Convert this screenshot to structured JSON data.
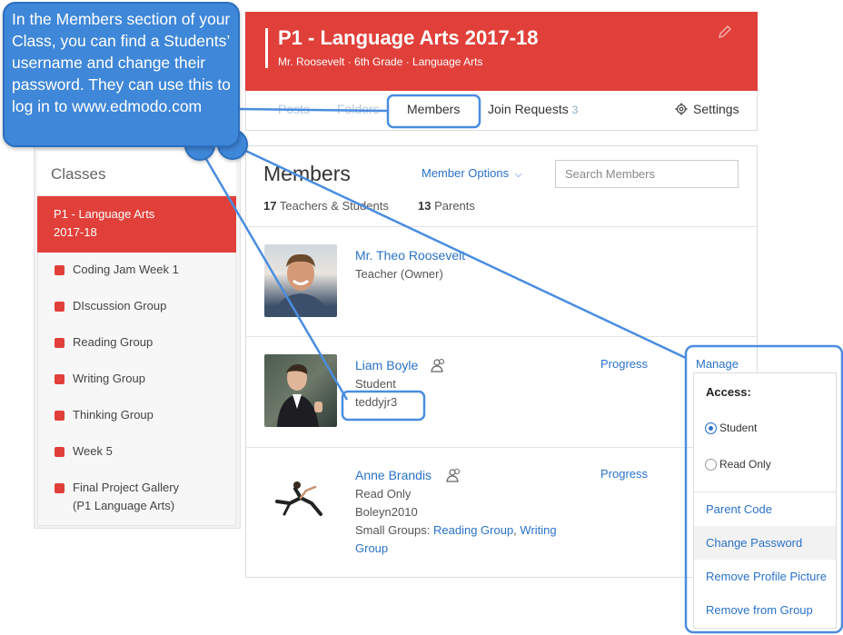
{
  "callout": {
    "text": "In the Members section of your Class, you can find a Students’ username and change their password. They can use this to log in to www.edmodo.com"
  },
  "sidebar": {
    "title": "Classes",
    "active_line1": "P1 - Language Arts",
    "active_line2": "2017-18",
    "items": [
      {
        "label": "Coding Jam Week 1"
      },
      {
        "label": "DIscussion Group"
      },
      {
        "label": "Reading Group"
      },
      {
        "label": "Writing Group"
      },
      {
        "label": "Thinking Group"
      },
      {
        "label": "Week 5"
      },
      {
        "label": "Final Project Gallery"
      }
    ],
    "final_sub": "(P1 Language Arts)"
  },
  "header": {
    "title": "P1 - Language Arts 2017-18",
    "subtitle": "Mr. Roosevelt · 6th Grade · Language Arts",
    "edit_icon": "pencil-icon",
    "brand_color": "#e1403a"
  },
  "tabs": {
    "posts": "Posts",
    "folders": "Folders",
    "members": "Members",
    "join_requests": "Join Requests",
    "join_requests_count": "3",
    "settings": "Settings"
  },
  "members": {
    "title": "Members",
    "options_label": "Member Options",
    "search_placeholder": "Search Members",
    "teachers_students_count": "17",
    "teachers_students_label": "Teachers & Students",
    "parents_count": "13",
    "parents_label": "Parents",
    "list": [
      {
        "name": "Mr. Theo Roosevelt",
        "role": "Teacher (Owner)"
      },
      {
        "name": "Liam Boyle",
        "role": "Student",
        "username": "teddyjr3",
        "progress": "Progress",
        "manage": "Manage"
      },
      {
        "name": "Anne Brandis",
        "role": "Read Only",
        "username": "Boleyn2010",
        "groups_label": "Small Groups:",
        "group1": "Reading Group",
        "group2": "Writing",
        "group2b": "Group",
        "progress": "Progress"
      }
    ]
  },
  "dropdown": {
    "access_label": "Access:",
    "options": [
      "Student",
      "Read Only"
    ],
    "selected": "Student",
    "links": [
      "Parent Code",
      "Change Password",
      "Remove Profile Picture",
      "Remove from Group"
    ]
  }
}
